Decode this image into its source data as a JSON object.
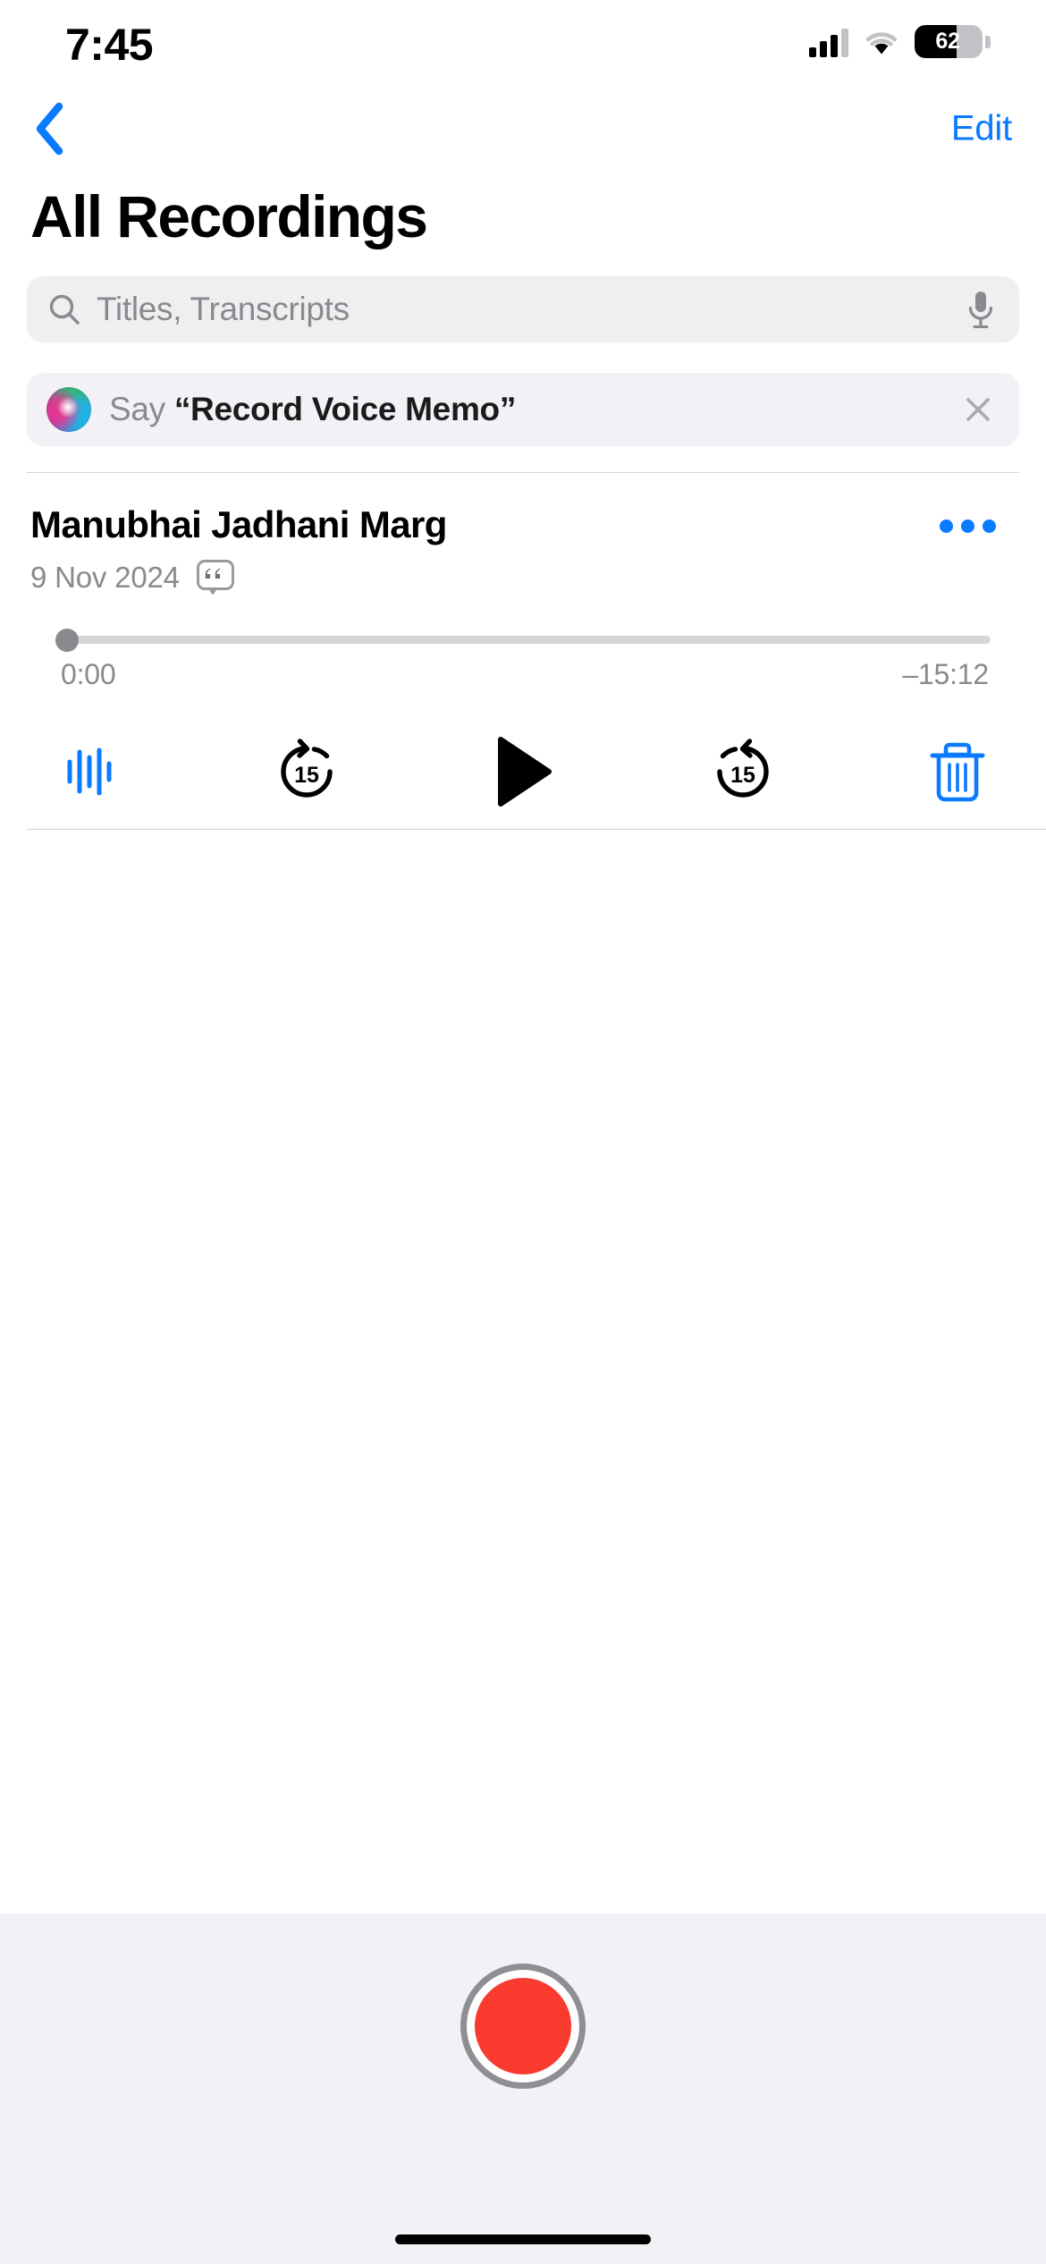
{
  "status_bar": {
    "time": "7:45",
    "battery_percent": "62",
    "battery_level": 62,
    "cellular_icon": "cellular-bars-icon",
    "wifi_icon": "wifi-icon",
    "battery_icon": "battery-icon"
  },
  "nav": {
    "back_icon": "chevron-left-icon",
    "edit_label": "Edit"
  },
  "header": {
    "title": "All Recordings"
  },
  "search": {
    "placeholder": "Titles, Transcripts",
    "value": "",
    "search_icon": "search-icon",
    "dictation_icon": "microphone-icon"
  },
  "siri_suggestion": {
    "orb_icon": "siri-orb-icon",
    "prefix": "Say",
    "phrase": "“Record Voice Memo”",
    "close_icon": "close-icon"
  },
  "recording": {
    "title": "Manubhai Jadhani Marg",
    "date": "9 Nov 2024",
    "transcript_icon": "transcript-quote-icon",
    "more_icon": "more-ellipsis-icon",
    "playback": {
      "current_time": "0:00",
      "remaining_time": "–15:12",
      "progress_percent": 0
    },
    "controls": {
      "waveform_label": "waveform-icon",
      "rewind_label": "15",
      "rewind_icon": "rewind-15-icon",
      "play_icon": "play-icon",
      "forward_label": "15",
      "forward_icon": "forward-15-icon",
      "delete_icon": "trash-icon"
    }
  },
  "footer": {
    "record_icon": "record-button",
    "home_indicator": "home-indicator"
  },
  "colors": {
    "accent_blue": "#0A7AFF",
    "record_red": "#F93A2F",
    "secondary_text": "#8A8A8E",
    "field_background": "#EFEEF0",
    "siri_background": "#F2F1F6",
    "footer_background": "#F2F1F6"
  }
}
